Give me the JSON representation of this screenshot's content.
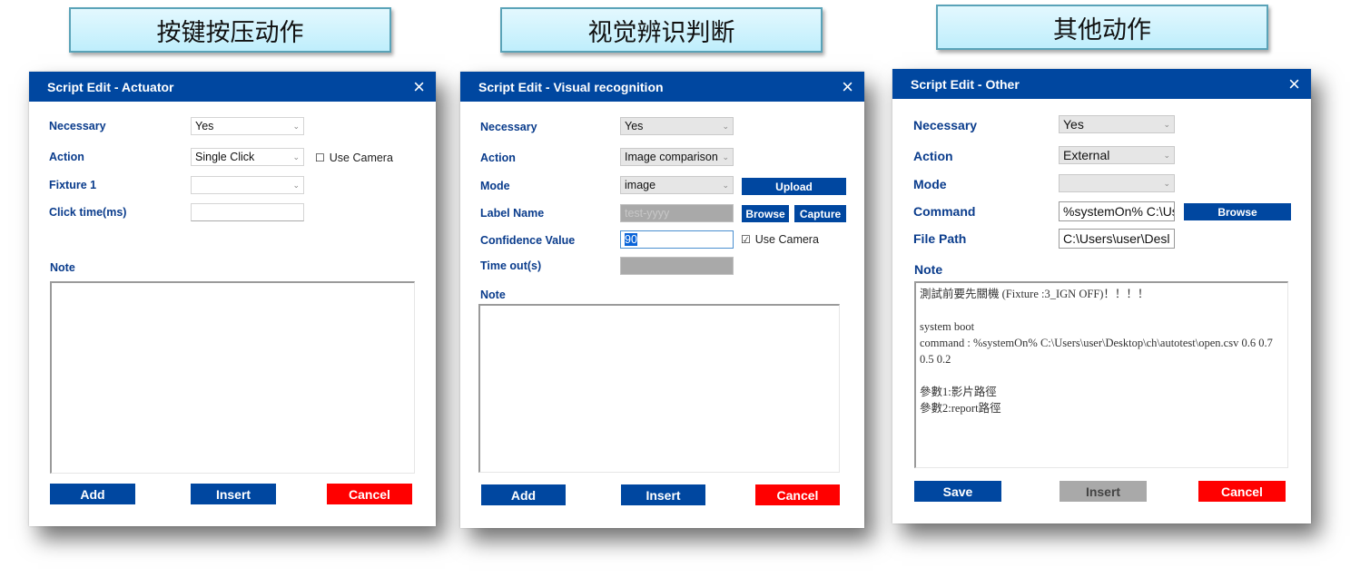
{
  "captions": [
    "按键按压动作",
    "视觉辨识判断",
    "其他动作"
  ],
  "dialogs": {
    "actuator": {
      "title": "Script Edit - Actuator",
      "close_icon": "×",
      "labels": {
        "necessary": "Necessary",
        "action": "Action",
        "fixture": "Fixture 1",
        "click_time": "Click time(ms)",
        "note": "Note"
      },
      "necessary_value": "Yes",
      "action_value": "Single Click",
      "fixture_value": "",
      "click_time_value": "",
      "use_camera": {
        "label": "Use Camera",
        "checked": false,
        "glyph": "☐"
      },
      "note_value": "",
      "buttons": {
        "add": "Add",
        "insert": "Insert",
        "cancel": "Cancel"
      }
    },
    "visual": {
      "title": "Script Edit - Visual recognition",
      "close_icon": "×",
      "labels": {
        "necessary": "Necessary",
        "action": "Action",
        "mode": "Mode",
        "label_name": "Label Name",
        "confidence": "Confidence Value",
        "timeout": "Time out(s)",
        "note": "Note"
      },
      "necessary_value": "Yes",
      "action_value": "Image comparison",
      "mode_value": "image",
      "label_name_value": "test-yyyy",
      "confidence_value": "90",
      "timeout_value": "",
      "use_camera": {
        "label": "Use Camera",
        "checked": true,
        "glyph": "☑"
      },
      "note_value": "",
      "buttons": {
        "upload": "Upload",
        "browse": "Browse",
        "capture": "Capture",
        "add": "Add",
        "insert": "Insert",
        "cancel": "Cancel"
      }
    },
    "other": {
      "title": "Script Edit - Other",
      "close_icon": "×",
      "labels": {
        "necessary": "Necessary",
        "action": "Action",
        "mode": "Mode",
        "command": "Command",
        "file_path": "File Path",
        "note": "Note"
      },
      "necessary_value": "Yes",
      "action_value": "External",
      "mode_value": "",
      "command_value": "%systemOn% C:\\Us",
      "file_path_value": "C:\\Users\\user\\Desl",
      "note_value": "測試前要先關機 (Fixture :3_IGN OFF)！！！！\n\nsystem boot\ncommand : %systemOn% C:\\Users\\user\\Desktop\\ch\\autotest\\open.csv 0.6 0.7 0.5 0.2\n\n參數1:影片路徑\n參數2:report路徑",
      "buttons": {
        "browse": "Browse",
        "save": "Save",
        "insert": "Insert",
        "cancel": "Cancel"
      }
    }
  },
  "colors": {
    "header_blue": "#0047a0",
    "label_blue": "#0a3c8c",
    "cancel_red": "#ff0000",
    "disabled_gray": "#a9a9a9"
  }
}
